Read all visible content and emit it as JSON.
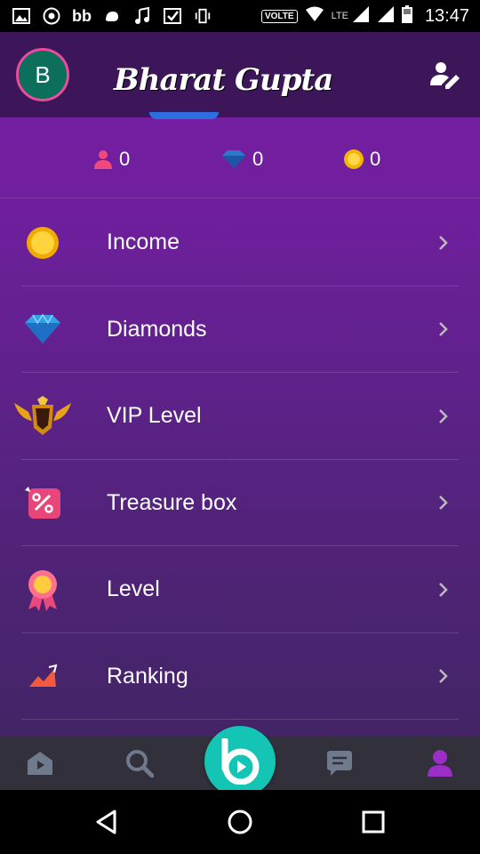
{
  "status_bar": {
    "network_label": "VOLTE",
    "lte_label": "LTE",
    "time": "13:47"
  },
  "header": {
    "avatar_letter": "B",
    "user_name": "Bharat Gupta"
  },
  "stats": {
    "followers": "0",
    "diamonds": "0",
    "coins": "0"
  },
  "menu": [
    {
      "label": "Income",
      "icon": "coin-icon"
    },
    {
      "label": "Diamonds",
      "icon": "diamond-icon"
    },
    {
      "label": "VIP Level",
      "icon": "vip-badge-icon"
    },
    {
      "label": "Treasure box",
      "icon": "treasure-box-icon"
    },
    {
      "label": "Level",
      "icon": "level-medal-icon"
    },
    {
      "label": "Ranking",
      "icon": "ranking-icon"
    }
  ],
  "bottom_nav": [
    "home-icon",
    "search-icon",
    "live-icon",
    "messages-icon",
    "profile-icon"
  ],
  "colors": {
    "accent": "#9b2ec4",
    "live_button": "#14c4b4",
    "header_bg": "#3c1659",
    "nav_bg": "#31303b"
  }
}
